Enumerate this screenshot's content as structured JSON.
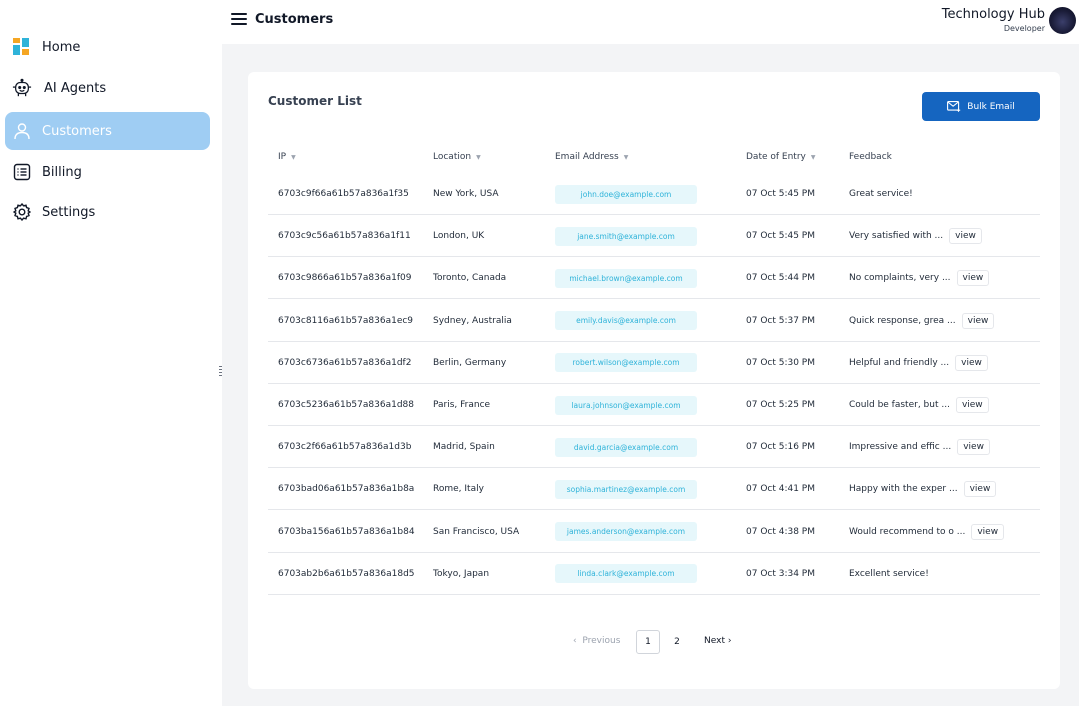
{
  "sidebar": {
    "items": [
      {
        "label": "Home",
        "icon": "home-grid-icon"
      },
      {
        "label": "AI Agents",
        "icon": "robot-icon"
      },
      {
        "label": "Customers",
        "icon": "user-icon"
      },
      {
        "label": "Billing",
        "icon": "list-icon"
      },
      {
        "label": "Settings",
        "icon": "gear-icon"
      }
    ],
    "active": "Customers"
  },
  "header": {
    "title": "Customers",
    "org_name": "Technology Hub",
    "org_role": "Developer"
  },
  "card": {
    "title": "Customer List",
    "bulk_email_label": "Bulk Email"
  },
  "table": {
    "columns": [
      {
        "label": "IP",
        "sortable": true
      },
      {
        "label": "Location",
        "sortable": true
      },
      {
        "label": "Email Address",
        "sortable": true
      },
      {
        "label": "Date of Entry",
        "sortable": true
      },
      {
        "label": "Feedback",
        "sortable": false
      }
    ],
    "view_label": "view",
    "rows": [
      {
        "ip": "6703c9f66a61b57a836a1f35",
        "location": "New York, USA",
        "email": "john.doe@example.com",
        "date": "07 Oct 5:45 PM",
        "feedback": "Great service!",
        "has_view": false
      },
      {
        "ip": "6703c9c56a61b57a836a1f11",
        "location": "London, UK",
        "email": "jane.smith@example.com",
        "date": "07 Oct 5:45 PM",
        "feedback": "Very satisfied with ...",
        "has_view": true
      },
      {
        "ip": "6703c9866a61b57a836a1f09",
        "location": "Toronto, Canada",
        "email": "michael.brown@example.com",
        "date": "07 Oct 5:44 PM",
        "feedback": "No complaints, very ...",
        "has_view": true
      },
      {
        "ip": "6703c8116a61b57a836a1ec9",
        "location": "Sydney, Australia",
        "email": "emily.davis@example.com",
        "date": "07 Oct 5:37 PM",
        "feedback": "Quick response, grea ...",
        "has_view": true
      },
      {
        "ip": "6703c6736a61b57a836a1df2",
        "location": "Berlin, Germany",
        "email": "robert.wilson@example.com",
        "date": "07 Oct 5:30 PM",
        "feedback": "Helpful and friendly ...",
        "has_view": true
      },
      {
        "ip": "6703c5236a61b57a836a1d88",
        "location": "Paris, France",
        "email": "laura.johnson@example.com",
        "date": "07 Oct 5:25 PM",
        "feedback": "Could be faster, but ...",
        "has_view": true
      },
      {
        "ip": "6703c2f66a61b57a836a1d3b",
        "location": "Madrid, Spain",
        "email": "david.garcia@example.com",
        "date": "07 Oct 5:16 PM",
        "feedback": "Impressive and effic ...",
        "has_view": true
      },
      {
        "ip": "6703bad06a61b57a836a1b8a",
        "location": "Rome, Italy",
        "email": "sophia.martinez@example.com",
        "date": "07 Oct 4:41 PM",
        "feedback": "Happy with the exper ...",
        "has_view": true
      },
      {
        "ip": "6703ba156a61b57a836a1b84",
        "location": "San Francisco, USA",
        "email": "james.anderson@example.com",
        "date": "07 Oct 4:38 PM",
        "feedback": "Would recommend to o ...",
        "has_view": true
      },
      {
        "ip": "6703ab2b6a61b57a836a18d5",
        "location": "Tokyo, Japan",
        "email": "linda.clark@example.com",
        "date": "07 Oct 3:34 PM",
        "feedback": "Excellent service!",
        "has_view": false
      }
    ]
  },
  "pagination": {
    "prev_label": "Previous",
    "next_label": "Next",
    "pages": [
      "1",
      "2"
    ],
    "current": "1"
  },
  "colors": {
    "accent": "#1565c0",
    "active_nav": "#9fcdf3",
    "email_text": "#2fb3d9",
    "email_bg": "#e6f7fb"
  }
}
